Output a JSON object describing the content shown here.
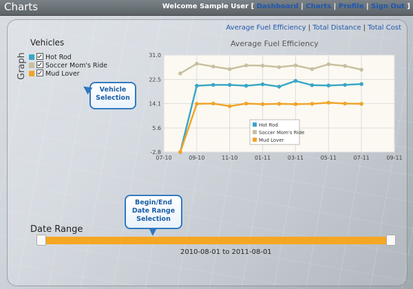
{
  "header": {
    "app_title": "Charts",
    "welcome_text": "Welcome Sample User",
    "links": [
      "Dashboard",
      "Charts",
      "Profile",
      "Sign Out"
    ]
  },
  "graph_panel": {
    "side_label": "Graph",
    "tabs": [
      "Average Fuel Efficiency",
      "Total Distance",
      "Total Cost"
    ]
  },
  "vehicles": {
    "title": "Vehicles",
    "items": [
      {
        "label": "Hot Rod",
        "checked": true,
        "color": "#3aa6c7"
      },
      {
        "label": "Soccer Mom's Ride",
        "checked": true,
        "color": "#c8bfa0"
      },
      {
        "label": "Mud Lover",
        "checked": true,
        "color": "#f0a42b"
      }
    ]
  },
  "callouts": {
    "vehicle_selection": "Vehicle Selection",
    "date_range_selection": "Begin/End Date Range Selection"
  },
  "date_range": {
    "label": "Date Range",
    "start": "2010-08-01",
    "separator": "to",
    "end": "2011-08-01",
    "accent": "#f5a623"
  },
  "chart_data": {
    "type": "line",
    "title": "Average Fuel Efficiency",
    "xlabel": "",
    "ylabel": "",
    "x": [
      "2010-08",
      "2010-09",
      "2010-10",
      "2010-11",
      "2010-12",
      "2011-01",
      "2011-02",
      "2011-03",
      "2011-04",
      "2011-05",
      "2011-06",
      "2011-07"
    ],
    "x_ticks": [
      "07-10",
      "09-10",
      "11-10",
      "01-11",
      "03-11",
      "05-11",
      "07-11",
      "09-11"
    ],
    "y_ticks": [
      "31.0",
      "22.5",
      "14.1",
      "5.6",
      "-2.8"
    ],
    "ylim": [
      -2.8,
      31.0
    ],
    "grid": true,
    "legend": "bottom-center",
    "series": [
      {
        "name": "Hot Rod",
        "color": "#3aa6c7",
        "values": [
          -2.8,
          20.3,
          20.6,
          20.6,
          20.3,
          20.8,
          20.0,
          22.0,
          20.5,
          20.4,
          20.6,
          20.9
        ]
      },
      {
        "name": "Soccer Mom's Ride",
        "color": "#c8bfa0",
        "values": [
          24.6,
          28.0,
          27.0,
          26.1,
          27.4,
          27.3,
          26.8,
          27.4,
          26.1,
          27.8,
          27.2,
          25.9
        ]
      },
      {
        "name": "Mud Lover",
        "color": "#f0a42b",
        "values": [
          -2.8,
          14.0,
          14.1,
          13.2,
          14.1,
          13.9,
          14.0,
          13.9,
          14.0,
          14.4,
          14.1,
          14.0
        ]
      }
    ]
  }
}
